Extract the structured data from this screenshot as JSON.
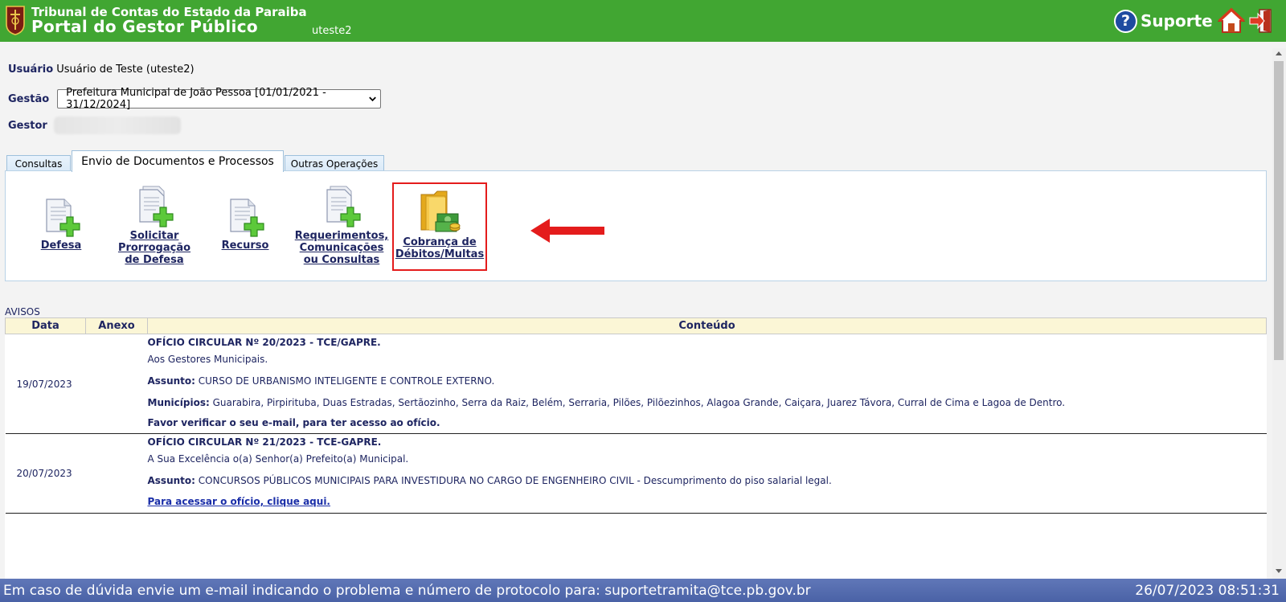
{
  "header": {
    "org": "Tribunal de Contas do Estado da Paraiba",
    "portal": "Portal do Gestor Público",
    "user": "uteste2",
    "support": "Suporte"
  },
  "info": {
    "usuario_label": "Usuário",
    "usuario_value": "Usuário de Teste (uteste2)",
    "gestao_label": "Gestão",
    "gestao_value": "Prefeitura Municipal de João Pessoa [01/01/2021 - 31/12/2024]",
    "gestor_label": "Gestor"
  },
  "tabs": [
    {
      "label": "Consultas"
    },
    {
      "label": "Envio de Documentos e Processos"
    },
    {
      "label": "Outras Operações"
    }
  ],
  "operations": [
    {
      "line1": "Defesa",
      "line2": "",
      "line3": ""
    },
    {
      "line1": "Solicitar",
      "line2": "Prorrogação",
      "line3": "de Defesa"
    },
    {
      "line1": "Recurso",
      "line2": "",
      "line3": ""
    },
    {
      "line1": "Requerimentos,",
      "line2": "Comunicações",
      "line3": "ou Consultas"
    },
    {
      "line1": "Cobrança de",
      "line2": "Débitos/Multas",
      "line3": ""
    }
  ],
  "avisos": {
    "title": "AVISOS",
    "headers": [
      "Data",
      "Anexo",
      "Conteúdo"
    ],
    "rows": [
      {
        "date": "19/07/2023",
        "title": "OFÍCIO CIRCULAR Nº 20/2023 - TCE/GAPRE.",
        "to": "Aos Gestores Municipais.",
        "assunto_label": "Assunto:",
        "assunto": "CURSO DE URBANISMO INTELIGENTE E CONTROLE EXTERNO.",
        "municipios_label": "Municípios:",
        "municipios": "Guarabira, Pirpirituba, Duas Estradas, Sertãozinho, Serra da Raiz, Belém, Serraria, Pilões, Pilõezinhos, Alagoa Grande, Caiçara, Juarez Távora, Curral de Cima e Lagoa de Dentro.",
        "note": "Favor verificar o seu e-mail, para ter acesso ao ofício."
      },
      {
        "date": "20/07/2023",
        "title": "OFÍCIO CIRCULAR Nº 21/2023 - TCE-GAPRE.",
        "to": "A Sua Excelência o(a) Senhor(a) Prefeito(a) Municipal.",
        "assunto_label": "Assunto:",
        "assunto": "CONCURSOS PÚBLICOS MUNICIPAIS PARA INVESTIDURA NO CARGO DE ENGENHEIRO CIVIL - Descumprimento do piso salarial legal.",
        "link": "Para acessar o ofício, clique aqui."
      }
    ]
  },
  "footer": {
    "message": "Em caso de dúvida envie um e-mail indicando o problema e número de protocolo para: suportetramita@tce.pb.gov.br",
    "datetime": "26/07/2023 08:51:31"
  },
  "colors": {
    "header_green": "#41a632",
    "footer_blue": "#4a62a6",
    "label_navy": "#1e2561",
    "highlight_red": "#e41c1c"
  },
  "icons": [
    "tce-seal-icon",
    "help-icon",
    "home-icon",
    "exit-icon",
    "document-add-icon",
    "folder-money-icon",
    "red-arrow-icon"
  ]
}
